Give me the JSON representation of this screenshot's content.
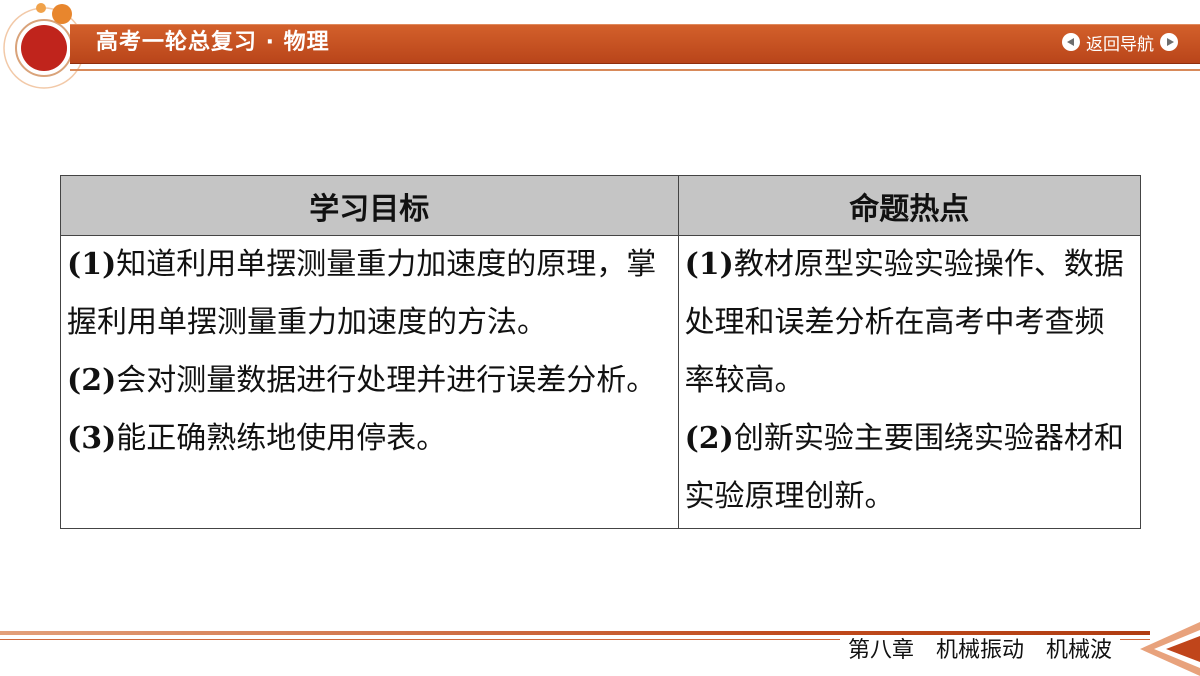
{
  "header": {
    "title": "高考一轮总复习 · 物理",
    "nav_label": "返回导航"
  },
  "table": {
    "headers": [
      "学习目标",
      "命题热点"
    ],
    "left_items": [
      {
        "num": "(1)",
        "text": "知道利用单摆测量重力加速度的原理，掌握利用单摆测量重力加速度的方法。"
      },
      {
        "num": "(2)",
        "text": "会对测量数据进行处理并进行误差分析。"
      },
      {
        "num": "(3)",
        "text": "能正确熟练地使用停表。"
      }
    ],
    "right_items": [
      {
        "num": "(1)",
        "text": "教材原型实验实验操作、数据处理和误差分析在高考中考查频率较高。"
      },
      {
        "num": "(2)",
        "text": "创新实验主要围绕实验器材和实验原理创新。"
      }
    ]
  },
  "footer": {
    "chapter": "第八章　机械振动　机械波"
  },
  "colors": {
    "header_bar": "#c4501f",
    "table_header_bg": "#c5c5c5",
    "accent_red": "#c0241c"
  }
}
